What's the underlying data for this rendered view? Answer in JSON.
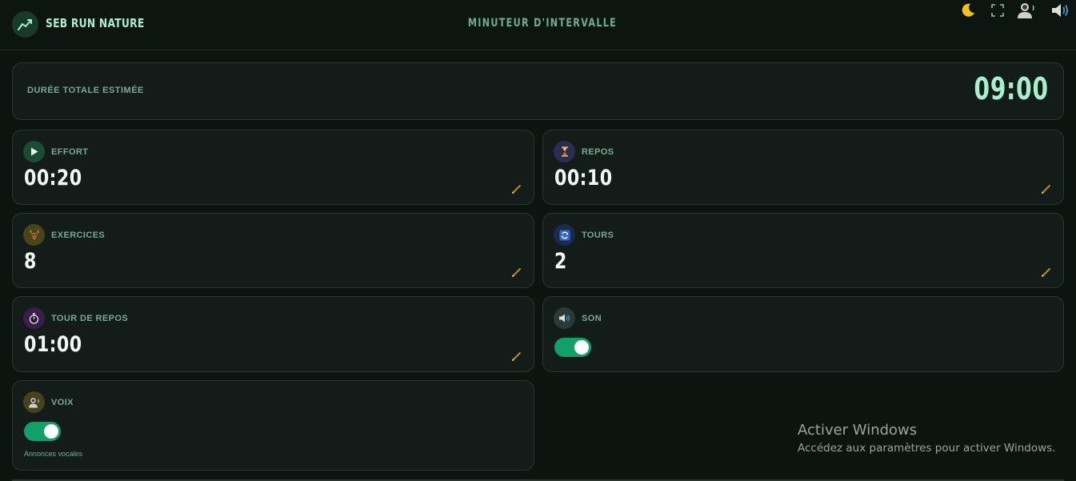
{
  "header": {
    "brand": "SEB RUN NATURE",
    "title": "MINUTEUR D'INTERVALLE",
    "icons": [
      "chart-line-icon",
      "moon-icon",
      "fullscreen-icon",
      "voice-person-icon",
      "speaker-icon"
    ]
  },
  "summary": {
    "label": "DURÉE TOTALE ESTIMÉE",
    "value": "09:00"
  },
  "cards": {
    "effort": {
      "label": "EFFORT",
      "value": "00:20",
      "icon": "play-icon"
    },
    "repos": {
      "label": "REPOS",
      "value": "00:10",
      "icon": "hourglass-icon"
    },
    "exercices": {
      "label": "EXERCICES",
      "value": "8",
      "icon": "deer-icon"
    },
    "tours": {
      "label": "TOURS",
      "value": "2",
      "icon": "repeat-icon"
    },
    "tour_repos": {
      "label": "TOUR DE REPOS",
      "value": "01:00",
      "icon": "stopwatch-icon"
    },
    "son": {
      "label": "SON",
      "enabled": true,
      "icon": "speaker-icon"
    },
    "voix": {
      "label": "VOIX",
      "enabled": true,
      "sub": "Annonces vocales",
      "icon": "voice-person-icon"
    }
  },
  "watermark": {
    "title": "Activer Windows",
    "subtitle": "Accédez aux paramètres pour activer Windows."
  },
  "colors": {
    "accent": "#a8f0cc",
    "toggle_on": "#12a06a",
    "card_bg": "#131c18",
    "page_bg": "#0c1410",
    "pencil": "#b8862e"
  }
}
